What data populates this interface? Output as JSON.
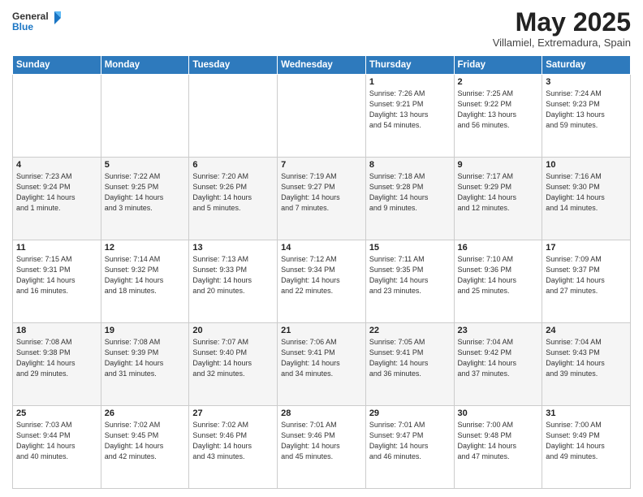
{
  "header": {
    "logo_line1": "General",
    "logo_line2": "Blue",
    "title": "May 2025",
    "location": "Villamiel, Extremadura, Spain"
  },
  "weekdays": [
    "Sunday",
    "Monday",
    "Tuesday",
    "Wednesday",
    "Thursday",
    "Friday",
    "Saturday"
  ],
  "weeks": [
    [
      {
        "day": "",
        "info": ""
      },
      {
        "day": "",
        "info": ""
      },
      {
        "day": "",
        "info": ""
      },
      {
        "day": "",
        "info": ""
      },
      {
        "day": "1",
        "info": "Sunrise: 7:26 AM\nSunset: 9:21 PM\nDaylight: 13 hours\nand 54 minutes."
      },
      {
        "day": "2",
        "info": "Sunrise: 7:25 AM\nSunset: 9:22 PM\nDaylight: 13 hours\nand 56 minutes."
      },
      {
        "day": "3",
        "info": "Sunrise: 7:24 AM\nSunset: 9:23 PM\nDaylight: 13 hours\nand 59 minutes."
      }
    ],
    [
      {
        "day": "4",
        "info": "Sunrise: 7:23 AM\nSunset: 9:24 PM\nDaylight: 14 hours\nand 1 minute."
      },
      {
        "day": "5",
        "info": "Sunrise: 7:22 AM\nSunset: 9:25 PM\nDaylight: 14 hours\nand 3 minutes."
      },
      {
        "day": "6",
        "info": "Sunrise: 7:20 AM\nSunset: 9:26 PM\nDaylight: 14 hours\nand 5 minutes."
      },
      {
        "day": "7",
        "info": "Sunrise: 7:19 AM\nSunset: 9:27 PM\nDaylight: 14 hours\nand 7 minutes."
      },
      {
        "day": "8",
        "info": "Sunrise: 7:18 AM\nSunset: 9:28 PM\nDaylight: 14 hours\nand 9 minutes."
      },
      {
        "day": "9",
        "info": "Sunrise: 7:17 AM\nSunset: 9:29 PM\nDaylight: 14 hours\nand 12 minutes."
      },
      {
        "day": "10",
        "info": "Sunrise: 7:16 AM\nSunset: 9:30 PM\nDaylight: 14 hours\nand 14 minutes."
      }
    ],
    [
      {
        "day": "11",
        "info": "Sunrise: 7:15 AM\nSunset: 9:31 PM\nDaylight: 14 hours\nand 16 minutes."
      },
      {
        "day": "12",
        "info": "Sunrise: 7:14 AM\nSunset: 9:32 PM\nDaylight: 14 hours\nand 18 minutes."
      },
      {
        "day": "13",
        "info": "Sunrise: 7:13 AM\nSunset: 9:33 PM\nDaylight: 14 hours\nand 20 minutes."
      },
      {
        "day": "14",
        "info": "Sunrise: 7:12 AM\nSunset: 9:34 PM\nDaylight: 14 hours\nand 22 minutes."
      },
      {
        "day": "15",
        "info": "Sunrise: 7:11 AM\nSunset: 9:35 PM\nDaylight: 14 hours\nand 23 minutes."
      },
      {
        "day": "16",
        "info": "Sunrise: 7:10 AM\nSunset: 9:36 PM\nDaylight: 14 hours\nand 25 minutes."
      },
      {
        "day": "17",
        "info": "Sunrise: 7:09 AM\nSunset: 9:37 PM\nDaylight: 14 hours\nand 27 minutes."
      }
    ],
    [
      {
        "day": "18",
        "info": "Sunrise: 7:08 AM\nSunset: 9:38 PM\nDaylight: 14 hours\nand 29 minutes."
      },
      {
        "day": "19",
        "info": "Sunrise: 7:08 AM\nSunset: 9:39 PM\nDaylight: 14 hours\nand 31 minutes."
      },
      {
        "day": "20",
        "info": "Sunrise: 7:07 AM\nSunset: 9:40 PM\nDaylight: 14 hours\nand 32 minutes."
      },
      {
        "day": "21",
        "info": "Sunrise: 7:06 AM\nSunset: 9:41 PM\nDaylight: 14 hours\nand 34 minutes."
      },
      {
        "day": "22",
        "info": "Sunrise: 7:05 AM\nSunset: 9:41 PM\nDaylight: 14 hours\nand 36 minutes."
      },
      {
        "day": "23",
        "info": "Sunrise: 7:04 AM\nSunset: 9:42 PM\nDaylight: 14 hours\nand 37 minutes."
      },
      {
        "day": "24",
        "info": "Sunrise: 7:04 AM\nSunset: 9:43 PM\nDaylight: 14 hours\nand 39 minutes."
      }
    ],
    [
      {
        "day": "25",
        "info": "Sunrise: 7:03 AM\nSunset: 9:44 PM\nDaylight: 14 hours\nand 40 minutes."
      },
      {
        "day": "26",
        "info": "Sunrise: 7:02 AM\nSunset: 9:45 PM\nDaylight: 14 hours\nand 42 minutes."
      },
      {
        "day": "27",
        "info": "Sunrise: 7:02 AM\nSunset: 9:46 PM\nDaylight: 14 hours\nand 43 minutes."
      },
      {
        "day": "28",
        "info": "Sunrise: 7:01 AM\nSunset: 9:46 PM\nDaylight: 14 hours\nand 45 minutes."
      },
      {
        "day": "29",
        "info": "Sunrise: 7:01 AM\nSunset: 9:47 PM\nDaylight: 14 hours\nand 46 minutes."
      },
      {
        "day": "30",
        "info": "Sunrise: 7:00 AM\nSunset: 9:48 PM\nDaylight: 14 hours\nand 47 minutes."
      },
      {
        "day": "31",
        "info": "Sunrise: 7:00 AM\nSunset: 9:49 PM\nDaylight: 14 hours\nand 49 minutes."
      }
    ]
  ]
}
